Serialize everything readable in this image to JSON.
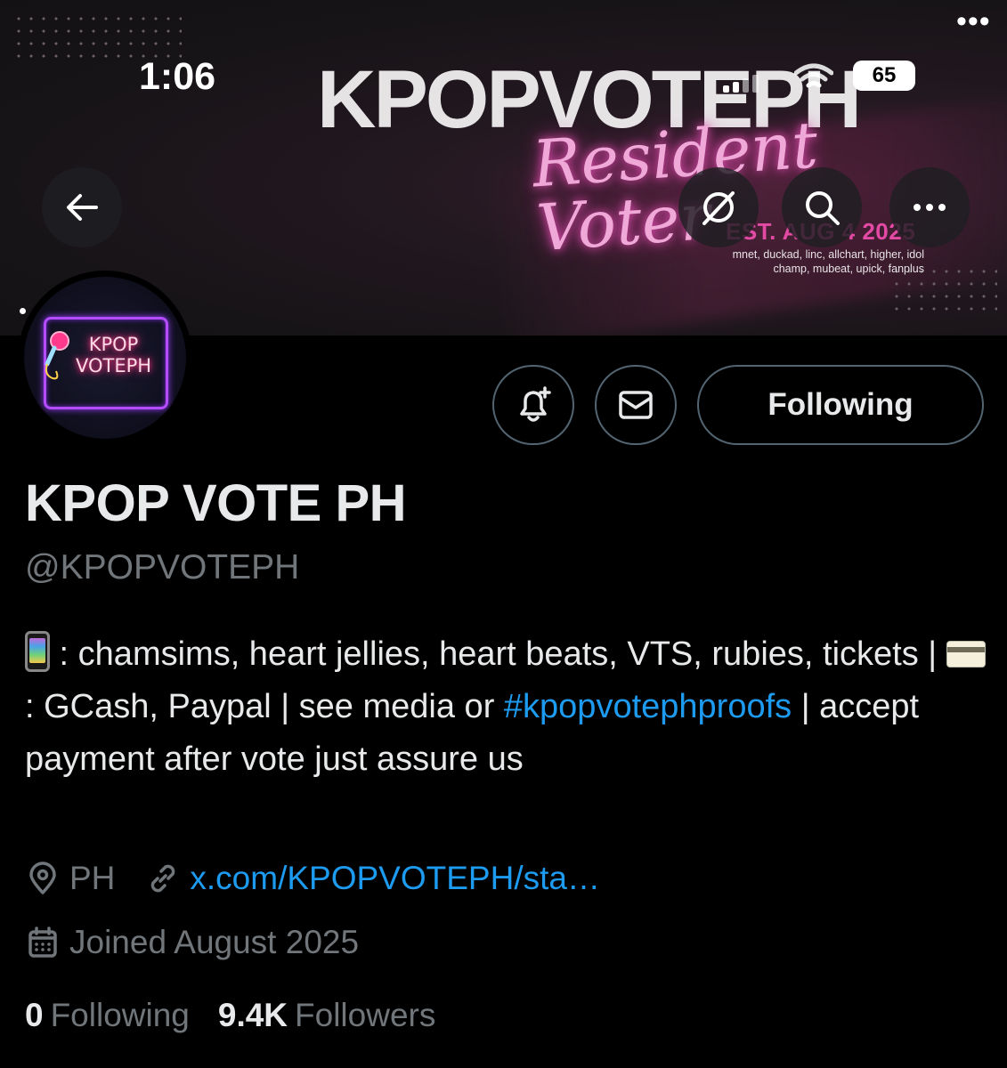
{
  "status_bar": {
    "time": "1:06",
    "battery": "65"
  },
  "banner": {
    "title": "KPOPVOTEPH",
    "script": "Resident Voter",
    "est": "EST. AUG 4 2025",
    "sub_line1": "mnet, duckad, linc, allchart, higher, idol",
    "sub_line2": "champ, mubeat, upick, fanplus"
  },
  "avatar": {
    "line1": "KPOP",
    "line2": "VOTEPH"
  },
  "actions": {
    "follow_label": "Following"
  },
  "profile": {
    "name": "KPOP VOTE PH",
    "handle": "@KPOPVOTEPH",
    "bio": {
      "part1": " : chamsims, heart jellies, heart beats, VTS, rubies, tickets | ",
      "part2": ": GCash, Paypal | see media or ",
      "hashtag": "#kpopvotephproofs",
      "part3": " | accept payment after vote just assure us"
    },
    "location": "PH",
    "link": "x.com/KPOPVOTEPH/sta…",
    "joined": "Joined August 2025",
    "following_count": "0",
    "following_label": "Following",
    "followers_count": "9.4K",
    "followers_label": "Followers"
  },
  "colors": {
    "accent_link": "#1d9bf0",
    "muted_text": "#71767b",
    "primary_text": "#e7e9ea",
    "neon_pink": "#e34aa3"
  },
  "icons": [
    "back-arrow-icon",
    "grok-icon",
    "search-icon",
    "more-icon",
    "bell-plus-icon",
    "mail-icon",
    "location-pin-icon",
    "link-icon",
    "calendar-icon"
  ]
}
